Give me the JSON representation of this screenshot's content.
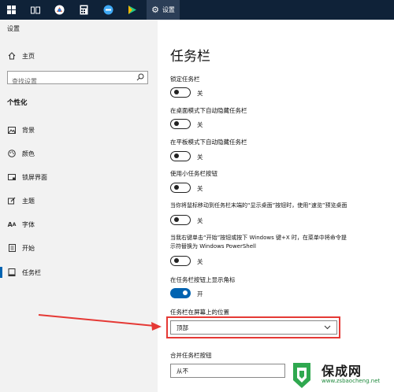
{
  "taskbar": {
    "window_title": "设置"
  },
  "app": {
    "title": "设置"
  },
  "sidebar": {
    "home": "主页",
    "search_placeholder": "查找设置",
    "section": "个性化",
    "items": [
      {
        "label": "背景",
        "icon": "image-icon"
      },
      {
        "label": "颜色",
        "icon": "palette-icon"
      },
      {
        "label": "锁屏界面",
        "icon": "lockscreen-icon"
      },
      {
        "label": "主题",
        "icon": "brush-icon"
      },
      {
        "label": "字体",
        "icon": "font-icon"
      },
      {
        "label": "开始",
        "icon": "start-icon"
      },
      {
        "label": "任务栏",
        "icon": "taskbar-icon",
        "active": true
      }
    ]
  },
  "main": {
    "title": "任务栏",
    "settings": [
      {
        "label": "锁定任务栏",
        "on": false,
        "state": "关"
      },
      {
        "label": "在桌面模式下自动隐藏任务栏",
        "on": false,
        "state": "关"
      },
      {
        "label": "在平板模式下自动隐藏任务栏",
        "on": false,
        "state": "关"
      },
      {
        "label": "使用小任务栏按钮",
        "on": false,
        "state": "关"
      },
      {
        "label": "当你将鼠标移动到任务栏末端的“显示桌面”按钮时，使用“速览”预览桌面",
        "on": false,
        "state": "关"
      },
      {
        "label_line1": "当我右键单击“开始”按钮或按下 Windows 键+X 时，在菜单中将命令提",
        "label_line2": "示符替换为 Windows PowerShell",
        "on": false,
        "state": "关"
      },
      {
        "label": "在任务栏按钮上显示角标",
        "on": true,
        "state": "开"
      }
    ],
    "position": {
      "label": "任务栏在屏幕上的位置",
      "value": "顶部"
    },
    "combine": {
      "label": "合并任务栏按钮",
      "value": "从不"
    }
  },
  "colors": {
    "accent": "#0063b1",
    "highlight": "#e53935",
    "taskbar": "#0f2238"
  },
  "watermark": {
    "name": "保成网",
    "url": "www.zsbaocheng.net"
  }
}
